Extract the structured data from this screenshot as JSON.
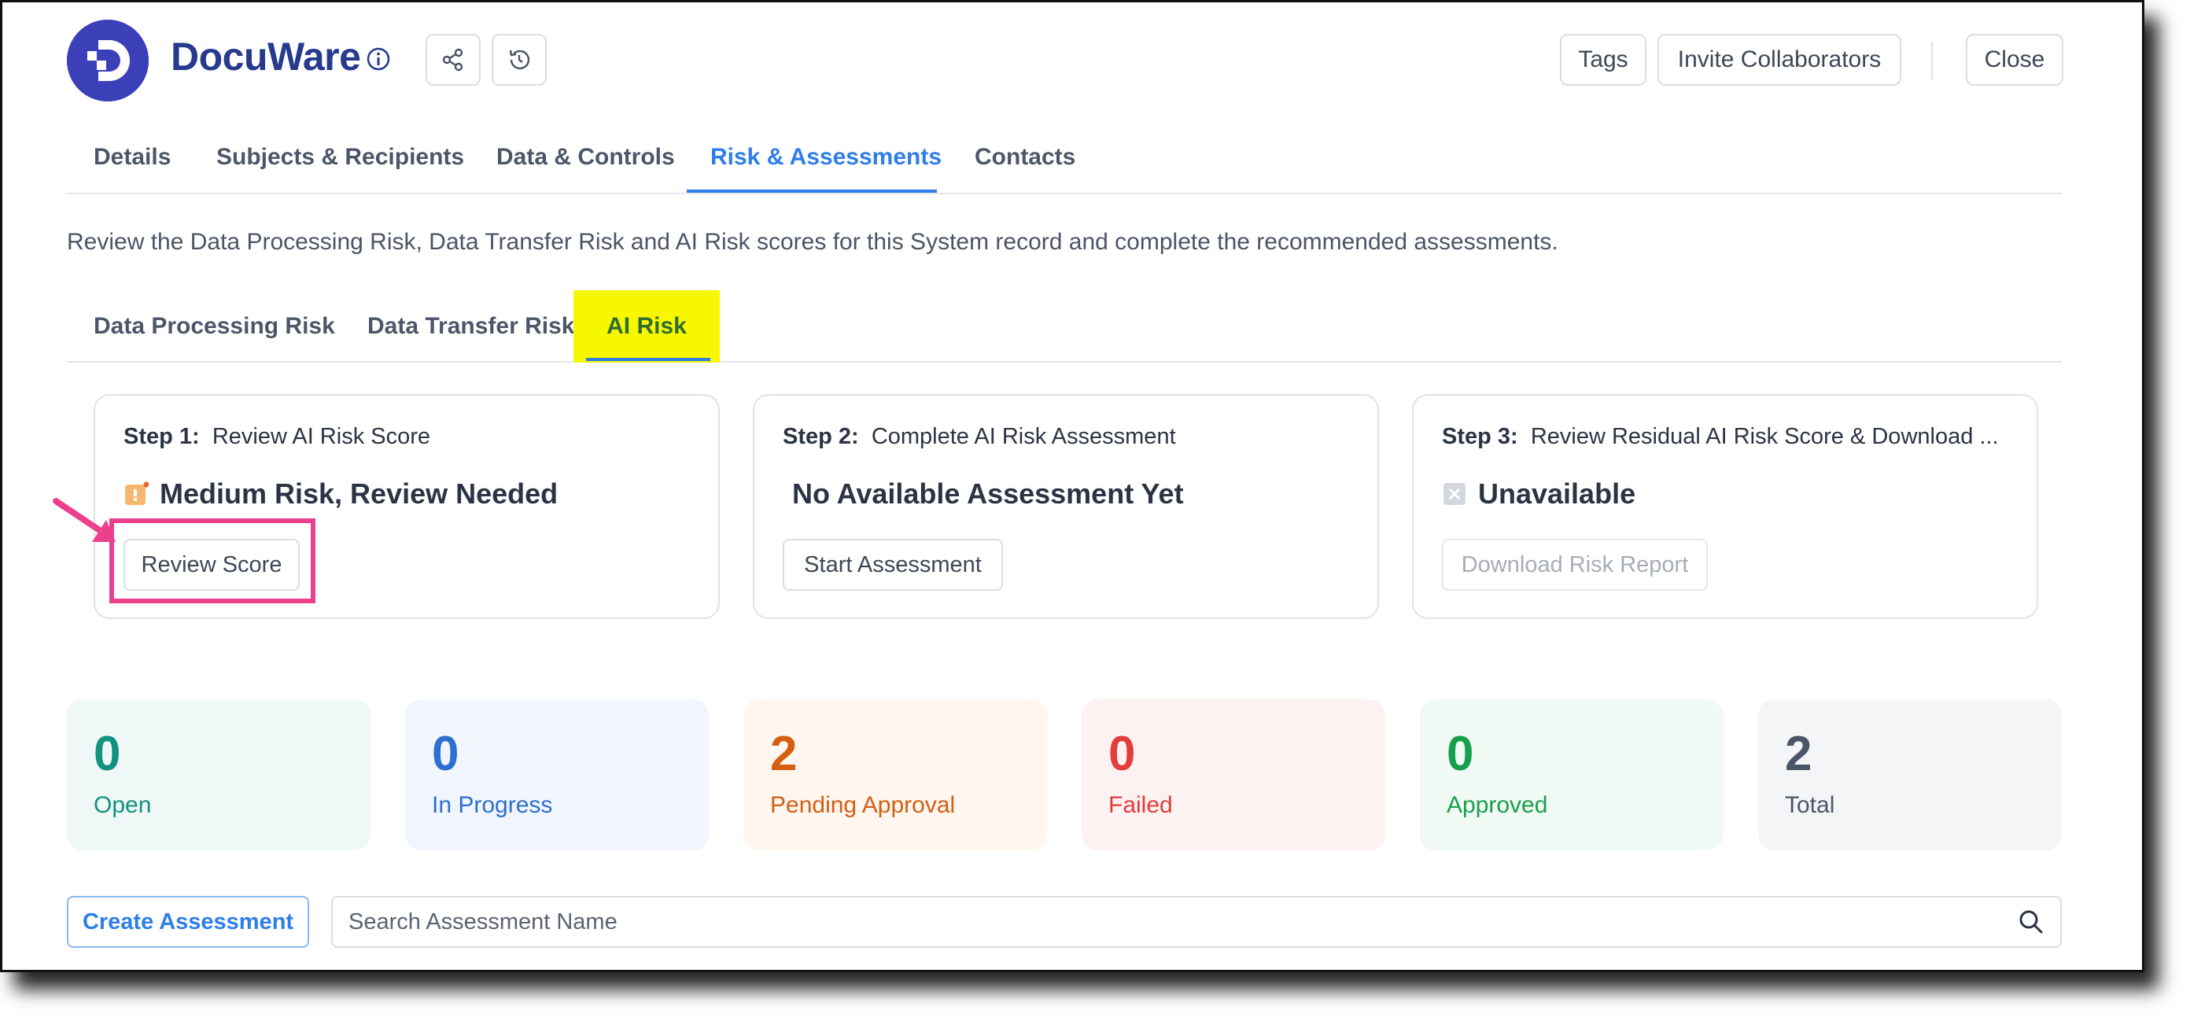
{
  "header": {
    "app_name": "DocuWare",
    "tags_label": "Tags",
    "invite_label": "Invite Collaborators",
    "close_label": "Close",
    "icons": [
      "info-icon",
      "share-icon",
      "history-icon"
    ]
  },
  "main_tabs": [
    {
      "label": "Details",
      "active": false
    },
    {
      "label": "Subjects & Recipients",
      "active": false
    },
    {
      "label": "Data & Controls",
      "active": false
    },
    {
      "label": "Risk & Assessments",
      "active": true
    },
    {
      "label": "Contacts",
      "active": false
    }
  ],
  "description": "Review the Data Processing Risk, Data Transfer Risk and AI Risk scores for this System record and complete the recommended assessments.",
  "sub_tabs": [
    {
      "label": "Data Processing Risk",
      "active": false
    },
    {
      "label": "Data Transfer Risk",
      "active": false
    },
    {
      "label": "AI Risk",
      "active": true
    }
  ],
  "steps": [
    {
      "step": "Step 1:",
      "title": "Review AI Risk Score",
      "status": "Medium Risk, Review Needed",
      "status_icon": "medium-risk-icon",
      "button": "Review Score",
      "button_enabled": true
    },
    {
      "step": "Step 2:",
      "title": "Complete AI Risk Assessment",
      "status": "No Available Assessment Yet",
      "status_icon": "",
      "button": "Start Assessment",
      "button_enabled": true
    },
    {
      "step": "Step 3:",
      "title": "Review Residual AI Risk Score & Download ...",
      "status": "Unavailable",
      "status_icon": "unavailable-icon",
      "button": "Download Risk Report",
      "button_enabled": false
    }
  ],
  "stats": [
    {
      "value": "0",
      "label": "Open",
      "color": "#11917f",
      "bg": "#eff8f7"
    },
    {
      "value": "0",
      "label": "In Progress",
      "color": "#2f6fd0",
      "bg": "#f1f5fc"
    },
    {
      "value": "2",
      "label": "Pending Approval",
      "color": "#d35f12",
      "bg": "#fff6ef"
    },
    {
      "value": "0",
      "label": "Failed",
      "color": "#e23c3c",
      "bg": "#fdf2f2"
    },
    {
      "value": "0",
      "label": "Approved",
      "color": "#17a04b",
      "bg": "#f0f9f3"
    },
    {
      "value": "2",
      "label": "Total",
      "color": "#4b5568",
      "bg": "#f4f5f7"
    }
  ],
  "actions": {
    "create_label": "Create Assessment",
    "search_placeholder": "Search Assessment Name",
    "search_value": ""
  },
  "colors": {
    "accent": "#2e7ee8",
    "brand": "#263a8e",
    "highlight": "#f7f700",
    "annotation": "#ec3f8c"
  }
}
